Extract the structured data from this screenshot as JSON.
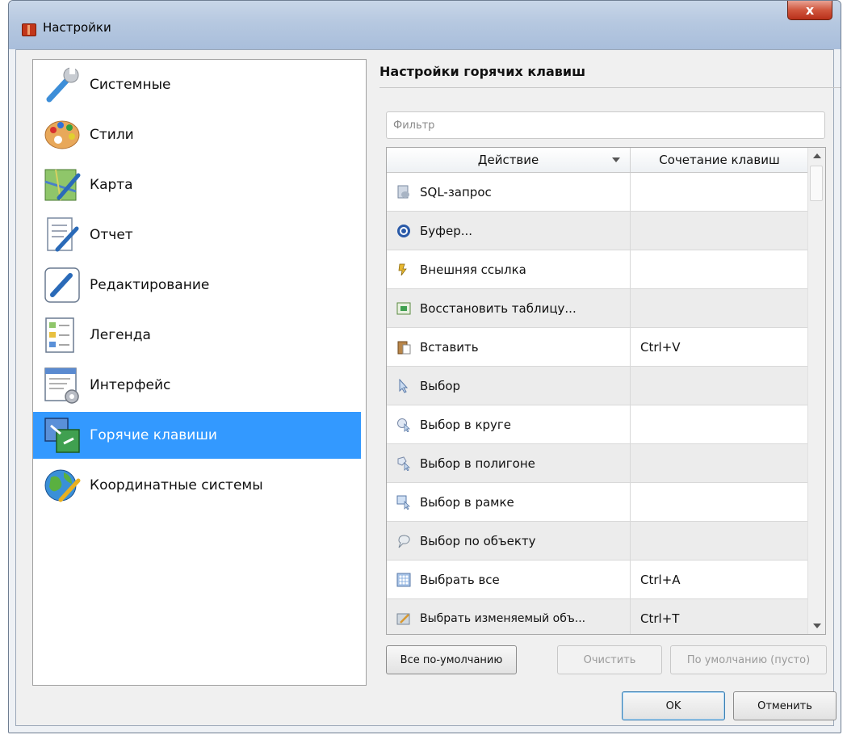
{
  "window": {
    "title": "Настройки",
    "close_label": "x"
  },
  "nav": {
    "items": [
      {
        "label": "Системные",
        "icon": "wrench-icon"
      },
      {
        "label": "Стили",
        "icon": "palette-icon"
      },
      {
        "label": "Карта",
        "icon": "map-icon"
      },
      {
        "label": "Отчет",
        "icon": "report-icon"
      },
      {
        "label": "Редактирование",
        "icon": "pencil-icon"
      },
      {
        "label": "Легенда",
        "icon": "legend-icon"
      },
      {
        "label": "Интерфейс",
        "icon": "interface-icon"
      },
      {
        "label": "Горячие клавиши",
        "icon": "hotkeys-icon",
        "selected": true
      },
      {
        "label": "Координатные системы",
        "icon": "globe-icon"
      }
    ]
  },
  "panel": {
    "title": "Настройки горячих клавиш",
    "filter_placeholder": "Фильтр",
    "filter_value": ""
  },
  "table": {
    "columns": {
      "action": "Действие",
      "shortcut": "Сочетание клавиш"
    },
    "rows": [
      {
        "action": "SQL-запрос",
        "shortcut": "",
        "icon": "sql-query-icon"
      },
      {
        "action": "Буфер...",
        "shortcut": "",
        "icon": "buffer-icon"
      },
      {
        "action": "Внешняя ссылка",
        "shortcut": "",
        "icon": "external-link-icon"
      },
      {
        "action": "Восстановить таблицу...",
        "shortcut": "",
        "icon": "restore-table-icon"
      },
      {
        "action": "Вставить",
        "shortcut": "Ctrl+V",
        "icon": "paste-icon"
      },
      {
        "action": "Выбор",
        "shortcut": "",
        "icon": "select-arrow-icon"
      },
      {
        "action": "Выбор в круге",
        "shortcut": "",
        "icon": "select-circle-icon"
      },
      {
        "action": "Выбор в полигоне",
        "shortcut": "",
        "icon": "select-polygon-icon"
      },
      {
        "action": "Выбор в рамке",
        "shortcut": "",
        "icon": "select-rectangle-icon"
      },
      {
        "action": "Выбор по объекту",
        "shortcut": "",
        "icon": "select-by-object-icon"
      },
      {
        "action": "Выбрать все",
        "shortcut": "Ctrl+A",
        "icon": "select-all-icon"
      },
      {
        "action": "Выбрать изменяемый объ...",
        "shortcut": "Ctrl+T",
        "icon": "select-editable-icon"
      }
    ]
  },
  "buttons": {
    "all_default": "Все по-умолчанию",
    "clear": "Очистить",
    "default_empty": "По умолчанию (пусто)",
    "ok": "OK",
    "cancel": "Отменить"
  }
}
